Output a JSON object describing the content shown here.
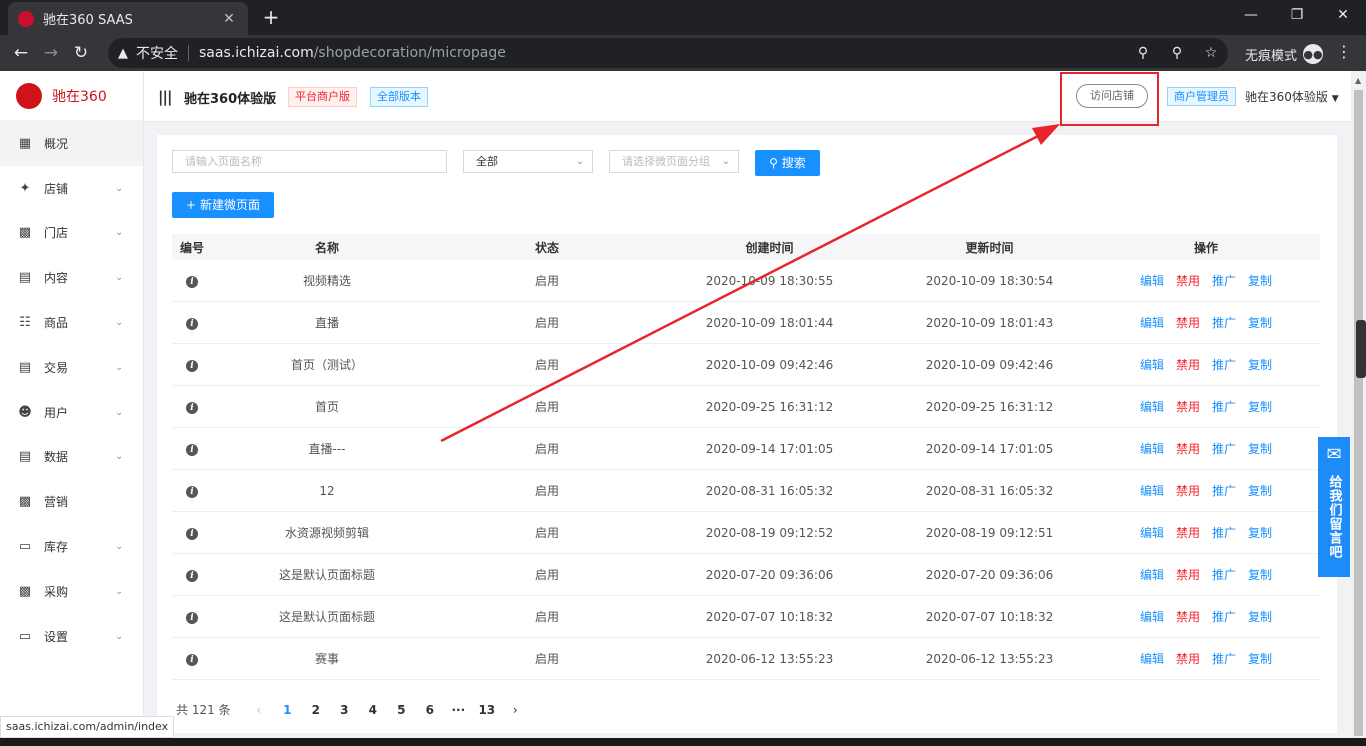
{
  "browser": {
    "tab_title": "驰在360 SAAS",
    "tab_close": "✕",
    "new_tab": "+",
    "insecure_label": "不安全",
    "url_host": "saas.ichizai.com",
    "url_path": "/shopdecoration/micropage",
    "incognito_label": "无痕模式",
    "status_url": "saas.ichizai.com/admin/index"
  },
  "sidebar": {
    "logo_mark": "驰在360",
    "logo_text": "驰在360",
    "items": [
      {
        "label": "概况",
        "icon": "dashboard-icon",
        "has_arrow": false
      },
      {
        "label": "店铺",
        "icon": "shop-icon",
        "has_arrow": true
      },
      {
        "label": "门店",
        "icon": "store-icon",
        "has_arrow": true
      },
      {
        "label": "内容",
        "icon": "content-icon",
        "has_arrow": true
      },
      {
        "label": "商品",
        "icon": "cart-icon",
        "has_arrow": true
      },
      {
        "label": "交易",
        "icon": "order-icon",
        "has_arrow": true
      },
      {
        "label": "用户",
        "icon": "user-icon",
        "has_arrow": true
      },
      {
        "label": "数据",
        "icon": "chart-icon",
        "has_arrow": true
      },
      {
        "label": "营销",
        "icon": "marketing-icon",
        "has_arrow": false
      },
      {
        "label": "库存",
        "icon": "warehouse-icon",
        "has_arrow": true
      },
      {
        "label": "采购",
        "icon": "purchase-icon",
        "has_arrow": true
      },
      {
        "label": "设置",
        "icon": "settings-icon",
        "has_arrow": true
      }
    ]
  },
  "header": {
    "shop_name": "驰在360体验版",
    "tag_platform": "平台商户版",
    "tag_version": "全部版本",
    "visit_store": "访问店铺",
    "role_tag": "商户管理员",
    "account_name": "驰在360体验版"
  },
  "filters": {
    "search_placeholder": "请输入页面名称",
    "status_select": "全部",
    "category_placeholder": "请选择微页面分组",
    "search_button": "搜索",
    "new_button": "新建微页面"
  },
  "table": {
    "headers": {
      "id": "编号",
      "name": "名称",
      "status": "状态",
      "created": "创建时间",
      "updated": "更新时间",
      "ops": "操作"
    },
    "ops": {
      "edit": "编辑",
      "disable": "禁用",
      "promote": "推广",
      "copy": "复制"
    },
    "rows": [
      {
        "name": "视频精选",
        "status": "启用",
        "created": "2020-10-09 18:30:55",
        "updated": "2020-10-09 18:30:54"
      },
      {
        "name": "直播",
        "status": "启用",
        "created": "2020-10-09 18:01:44",
        "updated": "2020-10-09 18:01:43"
      },
      {
        "name": "首页（测试）",
        "status": "启用",
        "created": "2020-10-09 09:42:46",
        "updated": "2020-10-09 09:42:46"
      },
      {
        "name": "首页",
        "status": "启用",
        "created": "2020-09-25 16:31:12",
        "updated": "2020-09-25 16:31:12"
      },
      {
        "name": "直播---",
        "status": "启用",
        "created": "2020-09-14 17:01:05",
        "updated": "2020-09-14 17:01:05"
      },
      {
        "name": "12",
        "status": "启用",
        "created": "2020-08-31 16:05:32",
        "updated": "2020-08-31 16:05:32"
      },
      {
        "name": "水资源视频剪辑",
        "status": "启用",
        "created": "2020-08-19 09:12:52",
        "updated": "2020-08-19 09:12:51"
      },
      {
        "name": "这是默认页面标题",
        "status": "启用",
        "created": "2020-07-20 09:36:06",
        "updated": "2020-07-20 09:36:06"
      },
      {
        "name": "这是默认页面标题",
        "status": "启用",
        "created": "2020-07-07 10:18:32",
        "updated": "2020-07-07 10:18:32"
      },
      {
        "name": "赛事",
        "status": "启用",
        "created": "2020-06-12 13:55:23",
        "updated": "2020-06-12 13:55:23"
      }
    ]
  },
  "pagination": {
    "total": "共 121 条",
    "pages": [
      "1",
      "2",
      "3",
      "4",
      "5",
      "6",
      "···",
      "13"
    ],
    "current": "1"
  },
  "float_feedback": "给我们留言吧",
  "colors": {
    "primary": "#1890ff",
    "danger": "#f5222d",
    "annotation": "#e8242c"
  }
}
